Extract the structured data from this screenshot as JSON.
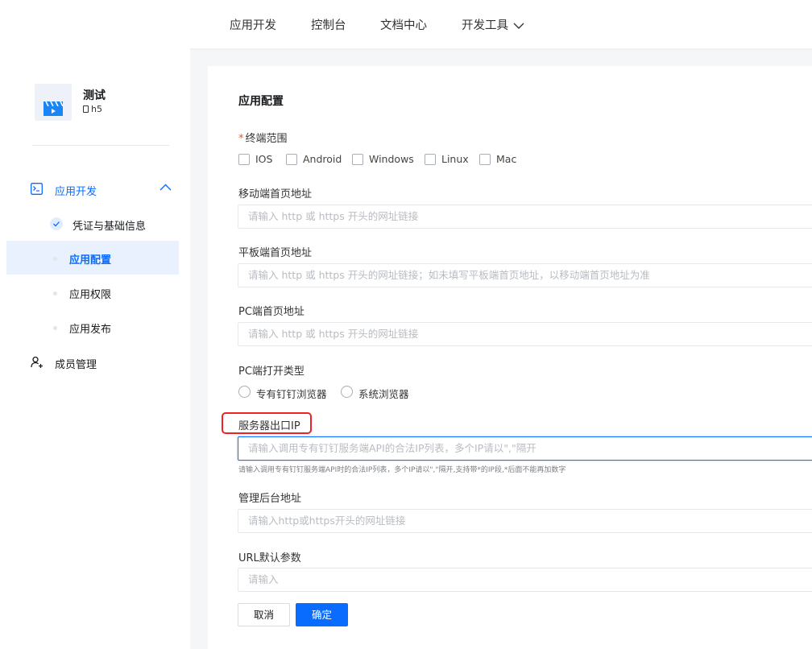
{
  "topnav": {
    "items": [
      "应用开发",
      "控制台",
      "文档中心",
      "开发工具"
    ]
  },
  "app": {
    "name": "测试",
    "type": "h5",
    "icon": "clapperboard-icon"
  },
  "sidebar": {
    "group_label": "应用开发",
    "subitems": [
      "凭证与基础信息",
      "应用配置",
      "应用权限",
      "应用发布"
    ],
    "active_item": "应用配置",
    "member_label": "成员管理"
  },
  "form": {
    "title": "应用配置",
    "terminal": {
      "label": "终端范围",
      "required_mark": "*",
      "options": [
        "IOS",
        "Android",
        "Windows",
        "Linux",
        "Mac"
      ]
    },
    "mobile_url": {
      "label": "移动端首页地址",
      "placeholder": "请输入 http 或 https 开头的网址链接"
    },
    "tablet_url": {
      "label": "平板端首页地址",
      "placeholder": "请输入 http 或 https 开头的网址链接；如未填写平板端首页地址，以移动端首页地址为准"
    },
    "pc_url": {
      "label": "PC端首页地址",
      "placeholder": "请输入 http 或 https 开头的网址链接"
    },
    "pc_open": {
      "label": "PC端打开类型",
      "options": [
        "专有钉钉浏览器",
        "系统浏览器"
      ]
    },
    "server_ip": {
      "label": "服务器出口IP",
      "placeholder": "请输入调用专有钉钉服务端API的合法IP列表，多个IP请以\",\"隔开",
      "hint": "请输入调用专有钉钉服务端API时的合法IP列表，多个IP请以\",\"隔开,支持带*的IP段,*后面不能再加数字"
    },
    "admin_url": {
      "label": "管理后台地址",
      "placeholder": "请输入http或https开头的网址链接"
    },
    "url_params": {
      "label": "URL默认参数",
      "placeholder": "请输入"
    },
    "cancel_label": "取消",
    "ok_label": "确定"
  },
  "colors": {
    "accent": "#0a6cff",
    "highlight_box": "#ee2222",
    "required": "#ff5219"
  }
}
